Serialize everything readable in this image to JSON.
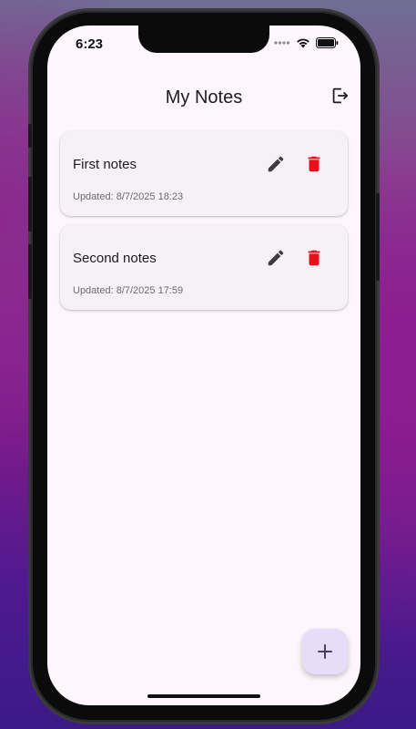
{
  "status_bar": {
    "time": "6:23",
    "icons": [
      "signal-icon",
      "wifi-icon",
      "battery-icon"
    ]
  },
  "app_bar": {
    "title": "My Notes",
    "action_icon": "logout-icon"
  },
  "notes": [
    {
      "title": "First notes",
      "updated": "Updated: 8/7/2025 18:23"
    },
    {
      "title": "Second notes",
      "updated": "Updated: 8/7/2025 17:59"
    }
  ],
  "fab": {
    "icon": "add-icon"
  },
  "colors": {
    "background": "#fdf6fd",
    "card": "#f6f0f7",
    "delete": "#e8101c",
    "edit": "#3d3a40",
    "fab": "#e9dcf8"
  }
}
